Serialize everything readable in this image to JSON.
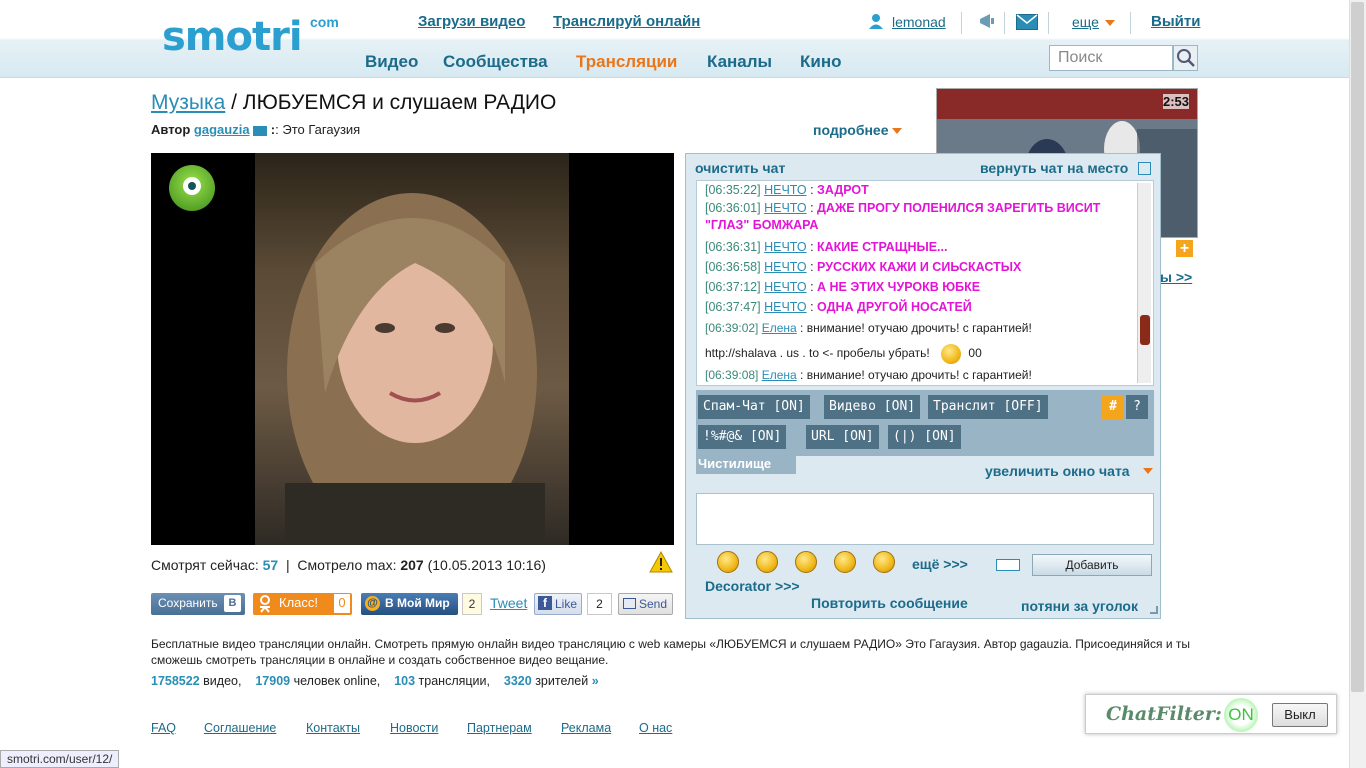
{
  "header": {
    "logo": "smotri",
    "logo_com": "com",
    "upload_link": "Загрузи видео",
    "broadcast_link": "Транслируй онлайн",
    "username": "lemonad",
    "more": "еще",
    "logout": "Выйти",
    "nav": [
      "Видео",
      "Сообщества",
      "Трансляции",
      "Каналы",
      "Кино"
    ],
    "active_nav": "Трансляции",
    "search_placeholder": "Поиск"
  },
  "page": {
    "category": "Музыка",
    "title_sep": " / ",
    "title": "ЛЮБУЕМСЯ и слушаем РАДИО",
    "author_label": "Автор",
    "author": "gagauzia",
    "author_note": ": Это Гагаузия",
    "more_link": "подробнее"
  },
  "stats": {
    "watching_label": "Смотрят сейчас:",
    "watching": "57",
    "max_label": "Смотрело max:",
    "max": "207",
    "max_date": "(10.05.2013 10:16)"
  },
  "social": {
    "save": "Сохранить",
    "class": "Класс!",
    "class_count": "0",
    "mymir": "В Мой Мир",
    "mymir_count": "2",
    "tweet": "Tweet",
    "like": "Like",
    "like_count": "2",
    "send": "Send"
  },
  "thumb": {
    "duration": "2:53",
    "more_link": "ы >>"
  },
  "chat": {
    "clear": "очистить чат",
    "restore": "вернуть чат на место",
    "messages": [
      {
        "time": "[06:35:22]",
        "user": "НЕЧТО",
        "text": "ЗАДРОТ",
        "style": "p"
      },
      {
        "time": "[06:36:01]",
        "user": "НЕЧТО",
        "text": "ДАЖЕ ПРОГУ ПОЛЕНИЛСЯ ЗАРЕГИТЬ ВИСИТ \"ГЛАЗ\" БОМЖАРА",
        "style": "p"
      },
      {
        "time": "[06:36:31]",
        "user": "НЕЧТО",
        "text": "КАКИЕ СТРАЩНЫЕ...",
        "style": "p"
      },
      {
        "time": "[06:36:58]",
        "user": "НЕЧТО",
        "text": "РУССКИХ КАЖИ И СИЬСКАСТЫХ",
        "style": "p"
      },
      {
        "time": "[06:37:12]",
        "user": "НЕЧТО",
        "text": "А НЕ ЭТИХ ЧУРОКВ ЮБКЕ",
        "style": "p"
      },
      {
        "time": "[06:37:47]",
        "user": "НЕЧТО",
        "text": "ОДНА ДРУГОЙ НОСАТЕЙ",
        "style": "p"
      },
      {
        "time": "[06:39:02]",
        "user": "Елена",
        "text": "внимание! отучаю дрочить! с гарантией!",
        "style": "n"
      },
      {
        "time": "",
        "user": "",
        "text": "http://shalava . us . to <- пробелы убрать!",
        "style": "n",
        "suffix": "00"
      },
      {
        "time": "[06:39:08]",
        "user": "Елена",
        "text": "внимание! отучаю дрочить! с гарантией!",
        "style": "n"
      }
    ],
    "filters": [
      "Спам-Чат [ON]",
      "Видево [ON]",
      "Транслит [OFF]",
      "!%#@& [ON]",
      "URL [ON]",
      "(|) [ON]"
    ],
    "hash": "#",
    "question": "?",
    "cleaner": "Чистилище",
    "enlarge": "увеличить окно чата",
    "more_smiles": "ещё >>>",
    "add": "Добавить",
    "decorator": "Decorator >>>",
    "repeat": "Повторить сообщение",
    "drag": "потяни за уголок"
  },
  "description": "Бесплатные видео трансляции онлайн. Смотреть прямую онлайн видео трансляцию с web камеры «ЛЮБУЕМСЯ и слушаем РАДИО» Это Гагаузия. Автор gagauzia. Присоединяйся и ты сможешь смотреть трансляции в онлайне и создать собственное видео вещание.",
  "counts": {
    "videos": "1758522",
    "videos_label": "видео,",
    "people": "17909",
    "people_label": "человек online,",
    "streams": "103",
    "streams_label": "трансляции,",
    "viewers": "3320",
    "viewers_label": "зрителей",
    "arrow": "»"
  },
  "footer": [
    "FAQ",
    "Соглашение",
    "Контакты",
    "Новости",
    "Партнерам",
    "Реклама",
    "О нас"
  ],
  "status_url": "smotri.com/user/12/",
  "chatfilter": {
    "title": "ChatFilter:",
    "state": "ON",
    "off_button": "Выкл"
  },
  "colors": {
    "accent": "#e8771c",
    "link": "#1b6b8a",
    "chat_pink": "#e414d7"
  }
}
